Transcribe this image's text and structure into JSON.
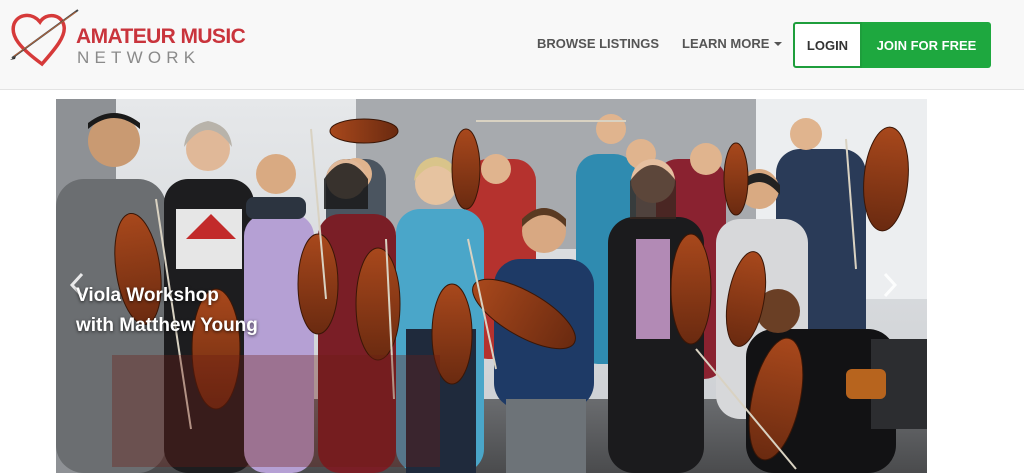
{
  "brand": {
    "line1": "AMATEUR MUSIC",
    "line2": "NETWORK",
    "colors": {
      "heart": "#d63a3a",
      "line1": "#c9343c",
      "line2": "#8a8a8a"
    },
    "icon": "heart-violin-logo"
  },
  "nav": {
    "browse_label": "BROWSE LISTINGS",
    "learn_label": "LEARN MORE",
    "login_label": "LOGIN",
    "join_label": "JOIN FOR FREE",
    "colors": {
      "join_bg": "#1ea83f",
      "login_border": "#1e9e3c",
      "link": "#555555"
    }
  },
  "carousel": {
    "caption_line1": "Viola Workshop",
    "caption_line2": "with Matthew Young",
    "prev_icon": "chevron-left-icon",
    "next_icon": "chevron-right-icon"
  }
}
